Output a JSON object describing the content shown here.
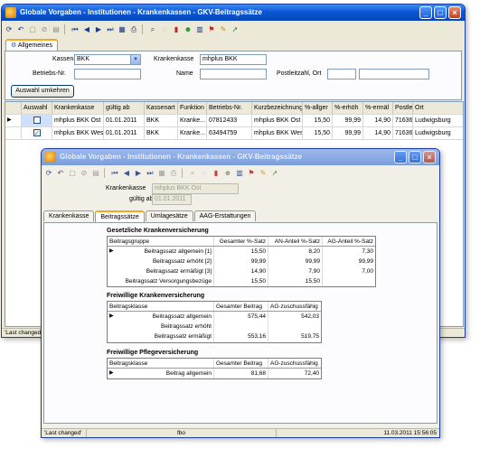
{
  "main_window": {
    "title": "Globale Vorgaben - Institutionen - Krankenkassen - GKV-Beitragssätze",
    "tab_label": "Allgemeines",
    "filters": {
      "kassenart_label": "Kassenart",
      "kassenart_value": "BKK",
      "krankenkasse_label": "Krankenkasse",
      "krankenkasse_value": "mhplus BKK",
      "betriebs_nr_label": "Betriebs-Nr.",
      "betriebs_nr_value": "",
      "name_label": "Name",
      "name_value": "",
      "postleitzahl_label": "Postleitzahl, Ort",
      "plz_value": "",
      "ort_value": ""
    },
    "invert_button_label": "Auswahl umkehren",
    "grid": {
      "columns": [
        "Auswahl",
        "Krankenkasse",
        "gültig ab",
        "Kassenart",
        "Funktion",
        "Betriebs-Nr.",
        "Kurzbezeichnung",
        "%-allger",
        "%-erhöh",
        "%-ermäl",
        "Postlei",
        "Ort"
      ],
      "rows": [
        {
          "auswahl": false,
          "krankenkasse": "mhplus BKK Ost",
          "gueltig_ab": "01.01.2011",
          "kassenart": "BKK",
          "funktion": "Kranke...",
          "betriebs_nr": "07812433",
          "kurzbezeichnung": "mhplus BKK Ost",
          "allg": "15,50",
          "erhoeh": "99,99",
          "ermaess": "14,90",
          "plz": "71636",
          "ort": "Ludwigsburg"
        },
        {
          "auswahl": true,
          "krankenkasse": "mhplus BKK West",
          "gueltig_ab": "01.01.2011",
          "kassenart": "BKK",
          "funktion": "Kranke...",
          "betriebs_nr": "63494759",
          "kurzbezeichnung": "mhplus BKK West",
          "allg": "15,50",
          "erhoeh": "99,99",
          "ermaess": "14,90",
          "plz": "71636",
          "ort": "Ludwigsburg"
        }
      ]
    },
    "status_left": "'Last changed'"
  },
  "detail_window": {
    "title": "Globale Vorgaben - Institutionen - Krankenkassen - GKV-Beitragssätze",
    "krankenkasse_label": "Krankenkasse",
    "krankenkasse_value": "mhplus BKK Ost",
    "gueltig_ab_label": "gültig ab",
    "gueltig_ab_value": "01.01.2011",
    "tabs": [
      "Krankenkasse",
      "Beitragssätze",
      "Umlagesätze",
      "AAG-Erstattungen"
    ],
    "gkv": {
      "title": "Gesetzliche Krankenversicherung",
      "headers": [
        "Beitragsgruppe",
        "Gesamter %-Satz",
        "AN-Anteil %-Satz",
        "AG-Anteil %-Satz"
      ],
      "rows": [
        {
          "name": "Beitragssatz allgemein [1]",
          "gesamt": "15,50",
          "an": "8,20",
          "ag": "7,30"
        },
        {
          "name": "Beitragssatz erhöht [2]",
          "gesamt": "99,99",
          "an": "99,99",
          "ag": "99,99"
        },
        {
          "name": "Beitragssatz ermäßigt [3]",
          "gesamt": "14,90",
          "an": "7,90",
          "ag": "7,00"
        },
        {
          "name": "Beitragssatz Versorgungsbezüge",
          "gesamt": "15,50",
          "an": "15,50",
          "ag": ""
        }
      ]
    },
    "fkv": {
      "title": "Freiwillige Krankenversicherung",
      "headers": [
        "Beitragsklasse",
        "Gesamter Beitrag",
        "AG-zuschussfähig"
      ],
      "rows": [
        {
          "name": "Beitragssatz allgemein",
          "gesamt": "575,44",
          "ag": "542,03"
        },
        {
          "name": "Beitragssatz erhöht",
          "gesamt": "",
          "ag": ""
        },
        {
          "name": "Beitragssatz ermäßigt",
          "gesamt": "553,16",
          "ag": "519,75"
        }
      ]
    },
    "fpv": {
      "title": "Freiwillige Pflegeversicherung",
      "headers": [
        "Beitragsklasse",
        "Gesamter Beitrag",
        "AG-zuschussfähig"
      ],
      "rows": [
        {
          "name": "Beitrag allgemein",
          "gesamt": "81,68",
          "ag": "72,40"
        }
      ]
    },
    "status": {
      "left": "'Last changed'",
      "user": "fbo",
      "timestamp": "11.03.2011 15:56:05"
    }
  }
}
